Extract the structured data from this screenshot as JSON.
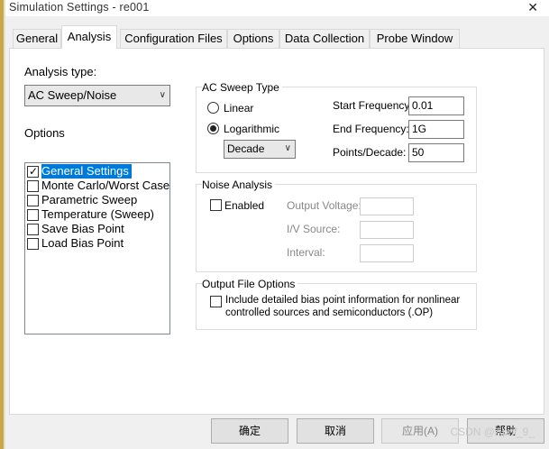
{
  "window": {
    "title": "Simulation Settings - re001",
    "close_glyph": "✕"
  },
  "tabs": [
    {
      "label": "General"
    },
    {
      "label": "Analysis"
    },
    {
      "label": "Configuration Files"
    },
    {
      "label": "Options"
    },
    {
      "label": "Data Collection"
    },
    {
      "label": "Probe Window"
    }
  ],
  "analysis_type": {
    "label": "Analysis type:",
    "value": "AC Sweep/Noise"
  },
  "options": {
    "label": "Options",
    "items": [
      {
        "label": "General Settings",
        "checked": true,
        "selected": true
      },
      {
        "label": "Monte Carlo/Worst Case",
        "checked": false,
        "selected": false
      },
      {
        "label": "Parametric Sweep",
        "checked": false,
        "selected": false
      },
      {
        "label": "Temperature (Sweep)",
        "checked": false,
        "selected": false
      },
      {
        "label": "Save Bias Point",
        "checked": false,
        "selected": false
      },
      {
        "label": "Load Bias Point",
        "checked": false,
        "selected": false
      }
    ]
  },
  "ac_sweep": {
    "title": "AC Sweep Type",
    "linear_label": "Linear",
    "log_label": "Logarithmic",
    "selected": "Logarithmic",
    "log_mode": "Decade",
    "start_label": "Start Frequency:",
    "start_value": "0.01",
    "end_label": "End Frequency:",
    "end_value": "1G",
    "points_label": "Points/Decade:",
    "points_value": "50"
  },
  "noise": {
    "title": "Noise Analysis",
    "enabled_label": "Enabled",
    "enabled": false,
    "output_voltage_label": "Output Voltage:",
    "iv_source_label": "I/V Source:",
    "interval_label": "Interval:"
  },
  "output_file": {
    "title": "Output File Options",
    "include_label_line1": "Include detailed bias point information for nonlinear",
    "include_label_line2": "controlled sources and semiconductors (.OP)",
    "checked": false
  },
  "buttons": {
    "ok": "确定",
    "cancel": "取消",
    "apply": "应用(A)",
    "help": "帮助"
  },
  "watermark": "CSDN @April_9_"
}
